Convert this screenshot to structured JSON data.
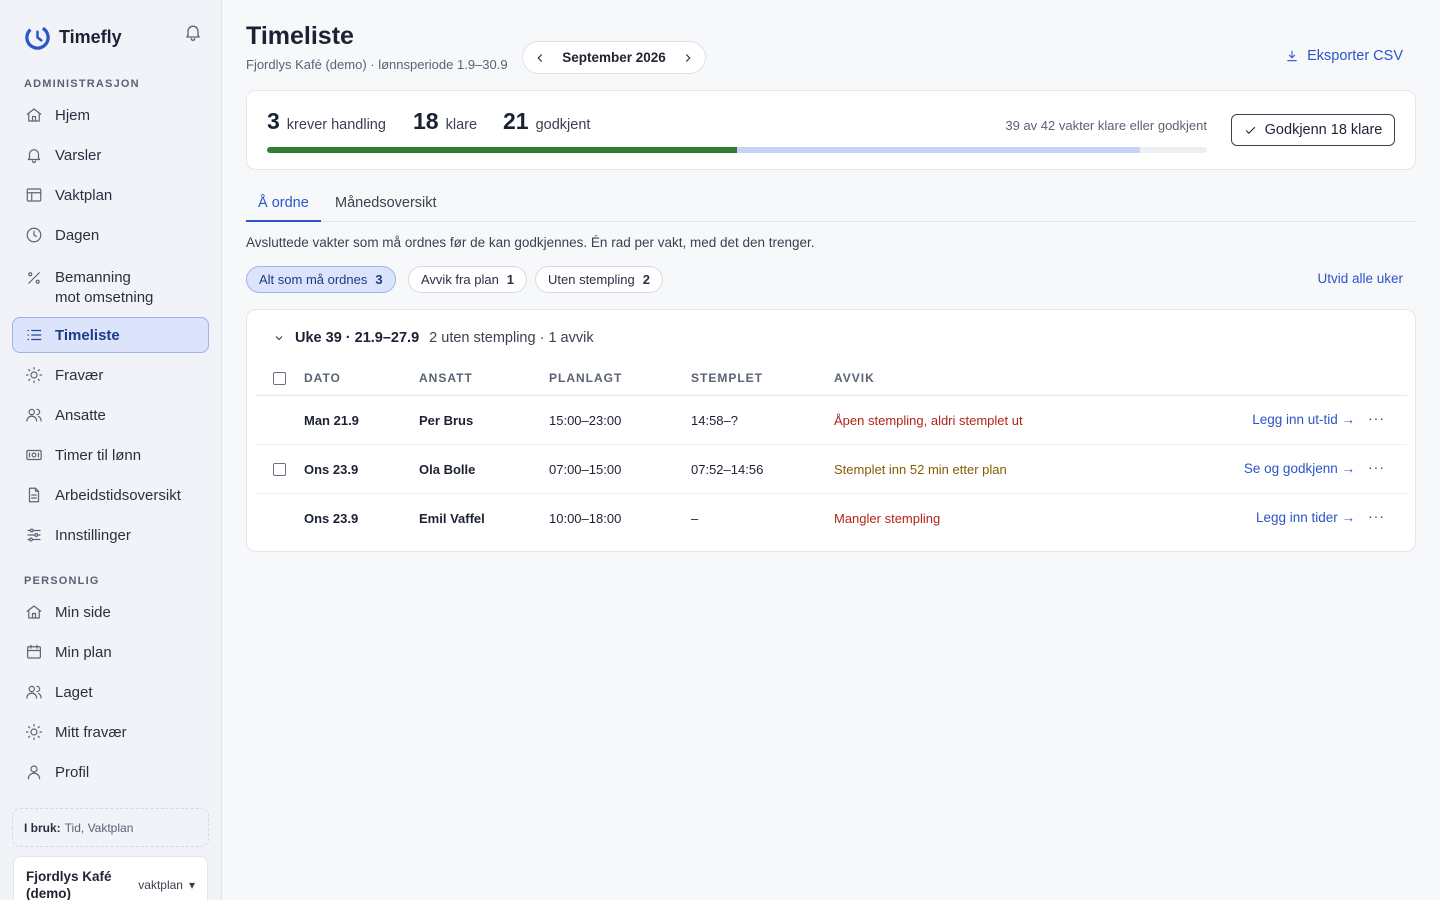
{
  "app": {
    "name": "Timefly"
  },
  "sidebar": {
    "sections": {
      "admin": "ADMINISTRASJON",
      "personal": "PERSONLIG"
    },
    "admin_items": [
      {
        "label": "Hjem",
        "icon": "home-icon"
      },
      {
        "label": "Varsler",
        "icon": "bell-icon"
      },
      {
        "label": "Vaktplan",
        "icon": "table-icon"
      },
      {
        "label": "Dagen",
        "icon": "clock-icon"
      },
      {
        "label": "Bemanning mot omsetning",
        "label_line1": "Bemanning",
        "label_line2": "mot omsetning",
        "icon": "percent-icon"
      },
      {
        "label": "Timeliste",
        "icon": "list-icon",
        "active": true
      },
      {
        "label": "Fravær",
        "icon": "sun-icon"
      },
      {
        "label": "Ansatte",
        "icon": "users-icon"
      },
      {
        "label": "Timer til lønn",
        "icon": "money-icon"
      },
      {
        "label": "Arbeidstidsoversikt",
        "icon": "document-icon"
      },
      {
        "label": "Innstillinger",
        "icon": "sliders-icon"
      }
    ],
    "personal_items": [
      {
        "label": "Min side",
        "icon": "home-icon"
      },
      {
        "label": "Min plan",
        "icon": "calendar-icon"
      },
      {
        "label": "Laget",
        "icon": "users-icon"
      },
      {
        "label": "Mitt fravær",
        "icon": "sun-icon"
      },
      {
        "label": "Profil",
        "icon": "user-icon"
      }
    ],
    "in_use_label": "I bruk:",
    "in_use_value": "Tid, Vaktplan",
    "org": {
      "name": "Fjordlys Kafé (demo)",
      "role": "vaktplan",
      "caret": "▾"
    }
  },
  "header": {
    "title": "Timeliste",
    "subtitle": "Fjordlys Kafé (demo) · lønnsperiode 1.9–30.9",
    "period": "September 2026",
    "export_label": "Eksporter CSV"
  },
  "summary": {
    "needs_action": {
      "count": "3",
      "label": "krever handling"
    },
    "ready": {
      "count": "18",
      "label": "klare"
    },
    "approved": {
      "count": "21",
      "label": "godkjent"
    },
    "progress": {
      "approved_fraction": 0.5,
      "ready_fraction": 0.4286,
      "approved_color": "#2e7d32",
      "ready_color": "#c7d3f4"
    },
    "note": "39 av 42 vakter klare eller godkjent",
    "approve_button": "Godkjenn 18 klare"
  },
  "tabs": [
    {
      "label": "Å ordne",
      "active": true
    },
    {
      "label": "Månedsoversikt"
    }
  ],
  "description": "Avsluttede vakter som må ordnes før de kan godkjennes. Én rad per vakt, med det den trenger.",
  "filters": [
    {
      "label": "Alt som må ordnes",
      "count": "3",
      "active": true
    },
    {
      "label": "Avvik fra plan",
      "count": "1"
    },
    {
      "label": "Uten stempling",
      "count": "2"
    }
  ],
  "expand_all": "Utvid alle uker",
  "week": {
    "title": "Uke 39 · 21.9–27.9",
    "meta": "2 uten stempling · 1 avvik",
    "columns": [
      "DATO",
      "ANSATT",
      "PLANLAGT",
      "STEMPLET",
      "AVVIK"
    ],
    "rows": [
      {
        "date": "Man 21.9",
        "employee": "Per Brus",
        "planned": "15:00–23:00",
        "stamped": "14:58–?",
        "deviation": "Åpen stempling, aldri stemplet ut",
        "action": "Legg inn ut-tid →",
        "more": "···"
      },
      {
        "date": "Ons 23.9",
        "employee": "Ola Bolle",
        "planned": "07:00–15:00",
        "stamped": "07:52–14:56",
        "deviation": "Stemplet inn 52 min etter plan",
        "action": "Se og godkjenn →",
        "more": "···"
      },
      {
        "date": "Ons 23.9",
        "employee": "Emil Vaffel",
        "planned": "10:00–18:00",
        "stamped": "–",
        "deviation": "Mangler stempling",
        "action": "Legg inn tider →",
        "more": "···"
      }
    ]
  }
}
